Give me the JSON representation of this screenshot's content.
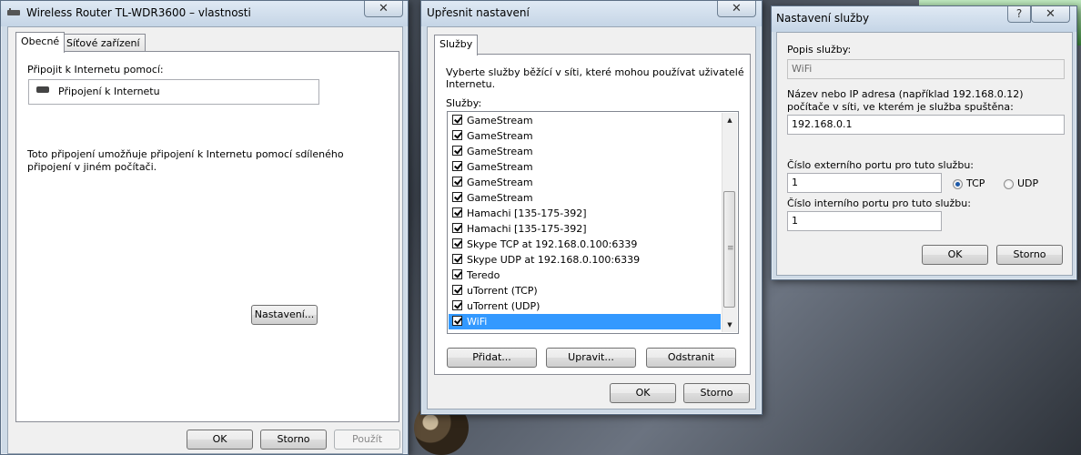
{
  "win1": {
    "title": "Wireless Router TL-WDR3600 – vlastnosti",
    "close": "✕",
    "tabs": [
      "Obecné",
      "Síťové zařízení"
    ],
    "connect_label": "Připojit k Internetu pomocí:",
    "connection_name": "Připojení k Internetu",
    "description": "Toto připojení umožňuje připojení k Internetu pomocí sdíleného",
    "description2": "připojení v jiném počítači.",
    "settings_button": "Nastavení...",
    "ok": "OK",
    "cancel": "Storno",
    "apply": "Použít"
  },
  "win2": {
    "title": "Upřesnit nastavení",
    "close": "✕",
    "tab": "Služby",
    "intro_line1": "Vyberte služby běžící v síti, které mohou používat uživatelé",
    "intro_line2": "Internetu.",
    "services_label": "Služby:",
    "services": [
      {
        "name": "GameStream",
        "checked": true
      },
      {
        "name": "GameStream",
        "checked": true
      },
      {
        "name": "GameStream",
        "checked": true
      },
      {
        "name": "GameStream",
        "checked": true
      },
      {
        "name": "GameStream",
        "checked": true
      },
      {
        "name": "GameStream",
        "checked": true
      },
      {
        "name": "Hamachi [135-175-392]",
        "checked": true
      },
      {
        "name": "Hamachi [135-175-392]",
        "checked": true
      },
      {
        "name": "Skype TCP at 192.168.0.100:6339",
        "checked": true
      },
      {
        "name": "Skype UDP at 192.168.0.100:6339",
        "checked": true
      },
      {
        "name": "Teredo",
        "checked": true
      },
      {
        "name": "uTorrent (TCP)",
        "checked": true
      },
      {
        "name": "uTorrent (UDP)",
        "checked": true
      },
      {
        "name": "WiFi",
        "checked": true,
        "selected": true
      }
    ],
    "add": "Přidat...",
    "edit": "Upravit...",
    "remove": "Odstranit",
    "ok": "OK",
    "cancel": "Storno"
  },
  "win3": {
    "title": "Nastavení služby",
    "help": "?",
    "close": "✕",
    "desc_label": "Popis služby:",
    "desc_value": "WiFi",
    "host_label1": "Název nebo IP adresa (například 192.168.0.12)",
    "host_label2": "počítače v síti, ve kterém je služba spuštěna:",
    "host_value": "192.168.0.1",
    "ext_port_label": "Číslo externího portu pro tuto službu:",
    "ext_port_value": "1",
    "int_port_label": "Číslo interního portu pro tuto službu:",
    "int_port_value": "1",
    "protocol_tcp": "TCP",
    "protocol_udp": "UDP",
    "protocol_selected": "TCP",
    "ok": "OK",
    "cancel": "Storno"
  }
}
